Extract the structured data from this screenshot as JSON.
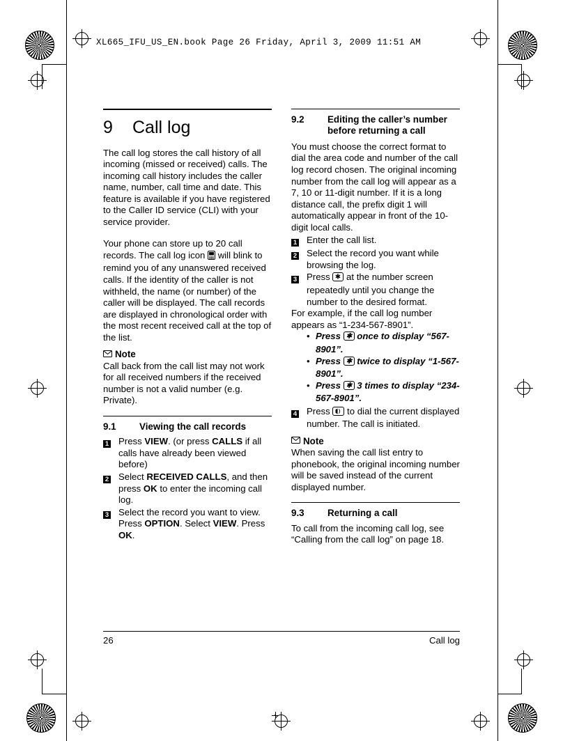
{
  "header": {
    "bookline": "XL665_IFU_US_EN.book  Page 26  Friday, April 3, 2009  11:51 AM"
  },
  "chapter": {
    "number": "9",
    "title": "Call log"
  },
  "left_column": {
    "intro_p1": "The call log stores the call history of all incoming (missed or received) calls. The incoming call history includes the caller name, number, call time and date. This feature is available if you have registered to the Caller ID service (CLI) with your service provider.",
    "intro_p2_a": "Your phone can store up to 20 call records. The call log icon ",
    "intro_p2_b": " will blink to remind you of any unanswered received calls. If the identity of the caller is not withheld, the name (or number) of the caller will be displayed. The call records are displayed in chronological order with the most recent received call at the top of the list.",
    "note_label": "Note",
    "note_text": "Call back from the call list may not work for all received numbers if the received number is not a valid number (e.g. Private).",
    "section": {
      "number": "9.1",
      "title": "Viewing the call records"
    },
    "steps": [
      {
        "marker": "1",
        "parts": [
          "Press ",
          "VIEW",
          ". (or press ",
          "CALLS",
          " if all calls have already been viewed before)"
        ]
      },
      {
        "marker": "2",
        "parts": [
          "Select ",
          "RECEIVED CALLS",
          ", and then press ",
          "OK",
          " to enter the incoming call log."
        ]
      },
      {
        "marker": "3",
        "parts": [
          "Select the record you want to view. Press ",
          "OPTION",
          ". Select ",
          "VIEW",
          ". Press ",
          "OK",
          "."
        ]
      }
    ]
  },
  "right_column": {
    "section_92": {
      "number": "9.2",
      "title_line1": "Editing the caller’s number",
      "title_line2": "before returning a call"
    },
    "p1": "You must choose the correct format to dial the area code and number of the call log record chosen. The original incoming number from the call log will appear as a 7, 10 or 11-digit number. If it is a long distance call, the prefix digit 1 will automatically appear in front of the 10-digit local calls.",
    "steps": [
      {
        "marker": "1",
        "text": "Enter the call list."
      },
      {
        "marker": "2",
        "text": "Select the record you want while browsing the log."
      },
      {
        "marker": "3",
        "text_a": "Press ",
        "text_b": " at the number screen repeatedly until you change the number to the desired format."
      }
    ],
    "example_lead": "For example, if the call log number appears as “1-234-567-8901”.",
    "bullets": [
      {
        "a": "Press ",
        "b": " once to display “567-8901”."
      },
      {
        "a": "Press ",
        "b": " twice to display “1-567-8901”."
      },
      {
        "a": "Press ",
        "b": " 3 times to display “234-567-8901”."
      }
    ],
    "step4": {
      "marker": "4",
      "text_a": "Press ",
      "text_b": " to dial the current displayed number. The call is initiated."
    },
    "note_label": "Note",
    "note_text": "When saving the call list entry to phonebook, the original incoming number will be saved instead of the current displayed number.",
    "section_93": {
      "number": "9.3",
      "title": "Returning a call"
    },
    "p2": "To call from the incoming call log, see “Calling from the call log” on page 18."
  },
  "footer": {
    "page_number": "26",
    "title": "Call log"
  },
  "icons": {
    "call_log": "call-log-icon",
    "star_key": "star-key-icon",
    "talk_key": "talk-key-icon",
    "note": "note-icon"
  }
}
